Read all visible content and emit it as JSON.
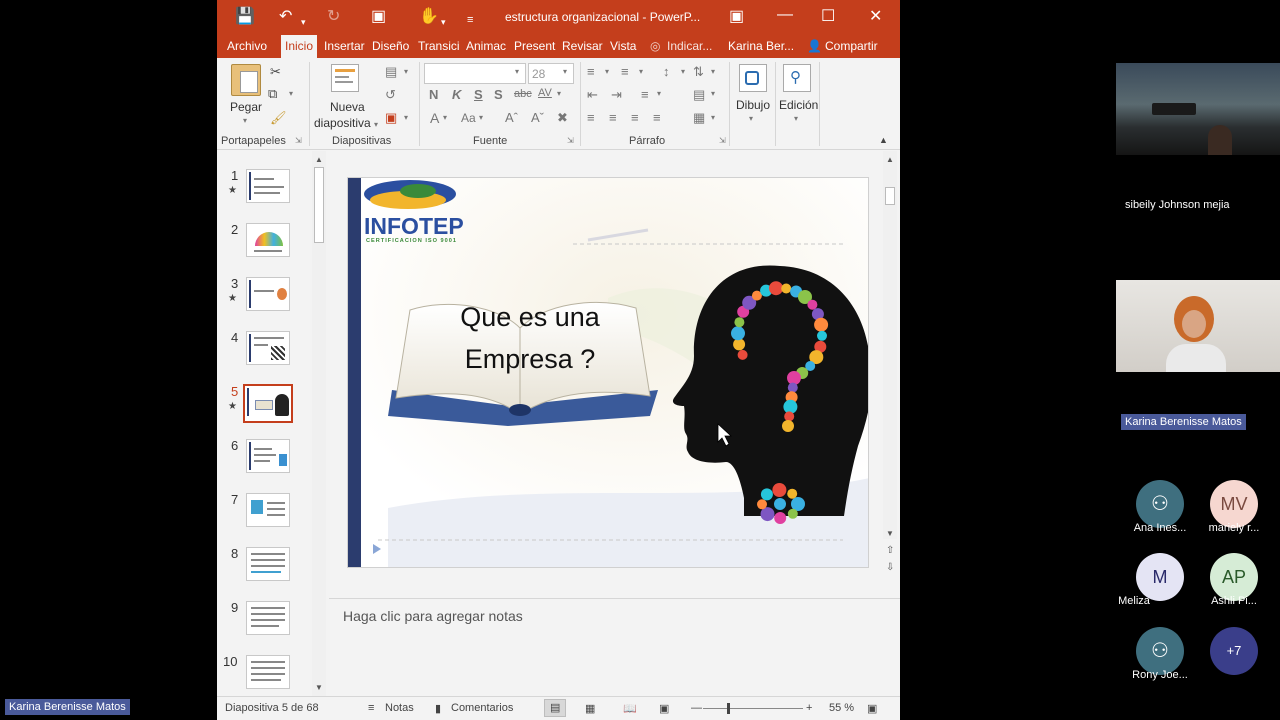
{
  "window": {
    "title": "estructura organizacional - PowerP...",
    "accent": "#c43e1c"
  },
  "tabs": [
    {
      "label": "Archivo"
    },
    {
      "label": "Inicio"
    },
    {
      "label": "Insertar"
    },
    {
      "label": "Diseño"
    },
    {
      "label": "Transici"
    },
    {
      "label": "Animac"
    },
    {
      "label": "Present"
    },
    {
      "label": "Revisar"
    },
    {
      "label": "Vista"
    },
    {
      "label": "Indicar..."
    },
    {
      "label": "Karina Ber..."
    },
    {
      "label": "Compartir"
    }
  ],
  "ribbon": {
    "paste_label": "Pegar",
    "new_slide_label_1": "Nueva",
    "new_slide_label_2": "diapositiva",
    "font_size_value": "28",
    "font_value": "",
    "draw_label": "Dibujo",
    "edit_label": "Edición",
    "groups": {
      "clipboard": "Portapapeles",
      "slides": "Diapositivas",
      "font": "Fuente",
      "paragraph": "Párrafo"
    },
    "font_buttons": [
      "N",
      "K",
      "S",
      "S",
      "abc",
      "AV"
    ],
    "font_buttons2": [
      "A",
      "Aa"
    ]
  },
  "thumbnails": [
    {
      "num": "1",
      "star": "★"
    },
    {
      "num": "2",
      "star": ""
    },
    {
      "num": "3",
      "star": "★"
    },
    {
      "num": "4",
      "star": ""
    },
    {
      "num": "5",
      "star": "★"
    },
    {
      "num": "6",
      "star": ""
    },
    {
      "num": "7",
      "star": ""
    },
    {
      "num": "8",
      "star": ""
    },
    {
      "num": "9",
      "star": ""
    },
    {
      "num": "10",
      "star": ""
    }
  ],
  "slide": {
    "logo_text": "INFOTEP",
    "logo_sub": "CERTIFICACION ISO 9001",
    "question_line1": "Que es una",
    "question_line2": "Empresa ?"
  },
  "notes_placeholder": "Haga clic para agregar notas",
  "status": {
    "slide_info": "Diapositiva 5 de 68",
    "notes": "Notas",
    "comments": "Comentarios",
    "zoom": "55 %"
  },
  "meeting": {
    "participant1_name": "sibeily Johnson mejia",
    "participant2_badge": "Karina  Berenisse Matos",
    "presenter_badge": "Karina  Berenisse Matos",
    "avatars": [
      {
        "initials": "",
        "name": "Ana Ines...",
        "bg": "#3f6f7f",
        "fg": "#ffffff"
      },
      {
        "initials": "MV",
        "name": "mariely r...",
        "bg": "#f6d7d0",
        "fg": "#7a4a40"
      },
      {
        "initials": "M",
        "name": "Meliza",
        "bg": "#e4e4f4",
        "fg": "#2a2a6a"
      },
      {
        "initials": "AP",
        "name": "Ashli Pi...",
        "bg": "#d6ecd6",
        "fg": "#2a5a2a"
      },
      {
        "initials": "",
        "name": "Rony Joe...",
        "bg": "#3f6f7f",
        "fg": "#ffffff"
      },
      {
        "initials": "+7",
        "name": "",
        "bg": "#3a3e8a",
        "fg": "#ffffff"
      }
    ]
  }
}
